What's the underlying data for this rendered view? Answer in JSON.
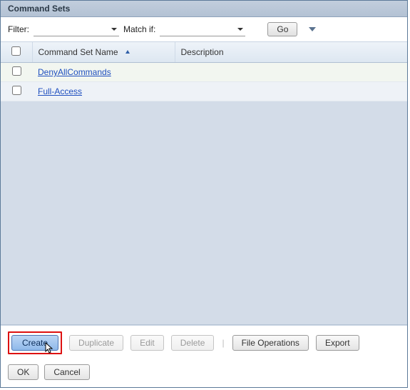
{
  "title": "Command Sets",
  "filter": {
    "label": "Filter:",
    "value": "",
    "match_label": "Match if:",
    "match_value": "",
    "go": "Go"
  },
  "table": {
    "columns": {
      "name": "Command Set Name",
      "description": "Description"
    },
    "sort": {
      "column": "name",
      "dir": "asc"
    },
    "rows": [
      {
        "name": "DenyAllCommands",
        "description": ""
      },
      {
        "name": "Full-Access",
        "description": ""
      }
    ]
  },
  "actions": {
    "create": "Create",
    "duplicate": "Duplicate",
    "edit": "Edit",
    "delete": "Delete",
    "file_ops": "File Operations",
    "export": "Export"
  },
  "footer": {
    "ok": "OK",
    "cancel": "Cancel"
  }
}
